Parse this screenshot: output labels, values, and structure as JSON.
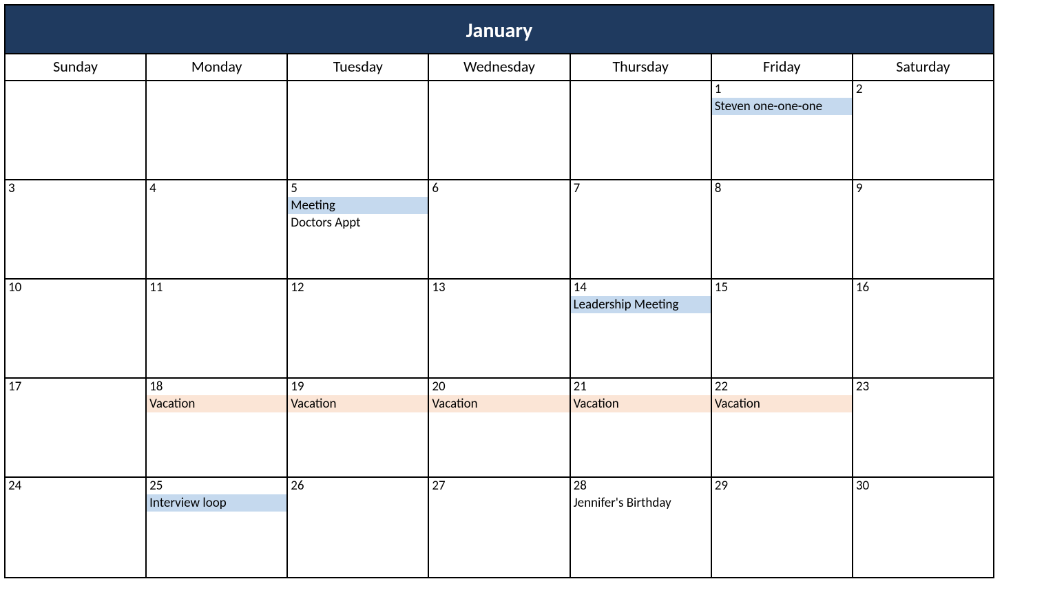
{
  "month_title": "January",
  "days_of_week": [
    "Sunday",
    "Monday",
    "Tuesday",
    "Wednesday",
    "Thursday",
    "Friday",
    "Saturday"
  ],
  "weeks": [
    [
      {
        "day": "",
        "events": []
      },
      {
        "day": "",
        "events": []
      },
      {
        "day": "",
        "events": []
      },
      {
        "day": "",
        "events": []
      },
      {
        "day": "",
        "events": []
      },
      {
        "day": "1",
        "events": [
          {
            "label": "Steven one-one-one",
            "highlight": "blue"
          }
        ]
      },
      {
        "day": "2",
        "events": []
      }
    ],
    [
      {
        "day": "3",
        "events": []
      },
      {
        "day": "4",
        "events": []
      },
      {
        "day": "5",
        "events": [
          {
            "label": "Meeting",
            "highlight": "blue"
          },
          {
            "label": "Doctors Appt",
            "highlight": "none"
          }
        ]
      },
      {
        "day": "6",
        "events": []
      },
      {
        "day": "7",
        "events": []
      },
      {
        "day": "8",
        "events": []
      },
      {
        "day": "9",
        "events": []
      }
    ],
    [
      {
        "day": "10",
        "events": []
      },
      {
        "day": "11",
        "events": []
      },
      {
        "day": "12",
        "events": []
      },
      {
        "day": "13",
        "events": []
      },
      {
        "day": "14",
        "events": [
          {
            "label": "Leadership Meeting",
            "highlight": "blue"
          }
        ]
      },
      {
        "day": "15",
        "events": []
      },
      {
        "day": "16",
        "events": []
      }
    ],
    [
      {
        "day": "17",
        "events": []
      },
      {
        "day": "18",
        "events": [
          {
            "label": "Vacation",
            "highlight": "orange"
          }
        ]
      },
      {
        "day": "19",
        "events": [
          {
            "label": "Vacation",
            "highlight": "orange"
          }
        ]
      },
      {
        "day": "20",
        "events": [
          {
            "label": "Vacation",
            "highlight": "orange"
          }
        ]
      },
      {
        "day": "21",
        "events": [
          {
            "label": "Vacation",
            "highlight": "orange"
          }
        ]
      },
      {
        "day": "22",
        "events": [
          {
            "label": "Vacation",
            "highlight": "orange"
          }
        ]
      },
      {
        "day": "23",
        "events": []
      }
    ],
    [
      {
        "day": "24",
        "events": []
      },
      {
        "day": "25",
        "events": [
          {
            "label": "Interview loop",
            "highlight": "blue"
          }
        ]
      },
      {
        "day": "26",
        "events": []
      },
      {
        "day": "27",
        "events": []
      },
      {
        "day": "28",
        "events": [
          {
            "label": "Jennifer's Birthday",
            "highlight": "none"
          }
        ]
      },
      {
        "day": "29",
        "events": []
      },
      {
        "day": "30",
        "events": []
      }
    ]
  ]
}
